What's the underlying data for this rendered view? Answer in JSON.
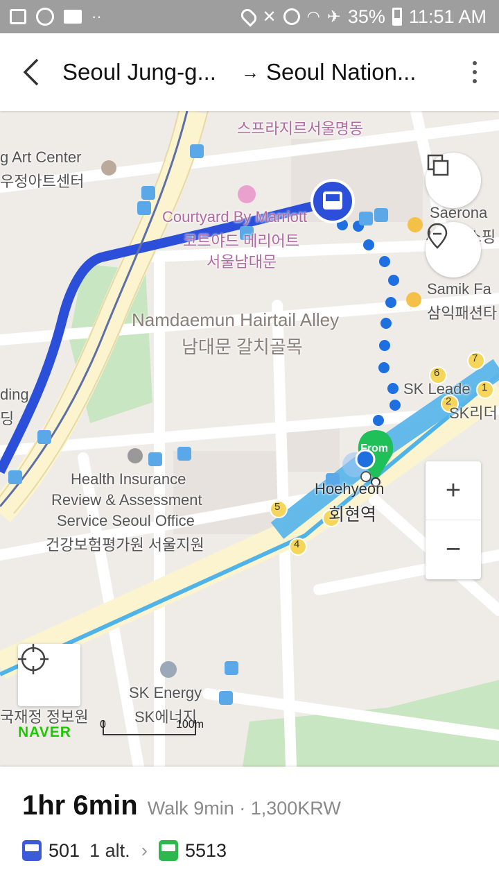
{
  "status_bar": {
    "battery": "35%",
    "time": "11:51 AM",
    "dots": "··"
  },
  "header": {
    "origin": "Seoul Jung-g...",
    "arrow": "→",
    "destination": "Seoul Nation..."
  },
  "map": {
    "labels": {
      "art_center_en": "g Art Center",
      "art_center_ko": "우정아트센터",
      "sprazir": "스프라지르서울명동",
      "courtyard_en": "Courtyard By Marriott",
      "courtyard_ko1": "코트야드 메리어트",
      "courtyard_ko2": "서울남대문",
      "saerona": "Saerona",
      "saerona_ko": "새로나쇼핑",
      "samik_en": "Samik Fa",
      "samik_ko": "삼익패션타",
      "namdaemun_en": "Namdaemun Hairtail Alley",
      "namdaemun_ko": "남대문 갈치골목",
      "sk_leaders_en": "SK Leade",
      "sk_leaders_ko": "SK리더",
      "building_en": "ding",
      "building_ko": "딩",
      "health_en1": "Health Insurance",
      "health_en2": "Review & Assessment",
      "health_en3": "Service Seoul Office",
      "health_ko": "건강보험평가원 서울지원",
      "hoehyeon_en": "Hoehyeon",
      "hoehyeon_ko": "회현역",
      "sk_energy_en": "SK Energy",
      "sk_energy_ko": "SK에너지",
      "finance_ko": "국재정 정보원",
      "from_pin": "From",
      "exit_4": "4",
      "exit_5": "5",
      "exit_6": "6",
      "exit_7": "7",
      "exit_1": "1",
      "exit_2": "2"
    },
    "naver_logo": "NAVER",
    "scale_start": "0",
    "scale_end": "100m",
    "zoom_in": "+",
    "zoom_out": "−"
  },
  "summary": {
    "duration": "1hr 6min",
    "details": "Walk 9min · 1,300KRW",
    "bus1": "501",
    "bus1_alt": "1 alt.",
    "bus2": "5513"
  },
  "colors": {
    "route_blue": "#2b4fd8",
    "walk_dots": "#1e6fe0",
    "subway_cyan": "#4fb3e8",
    "pin_green": "#1fbf5a",
    "bus_blue": "#3b5bdb",
    "bus_green": "#2db84d"
  }
}
